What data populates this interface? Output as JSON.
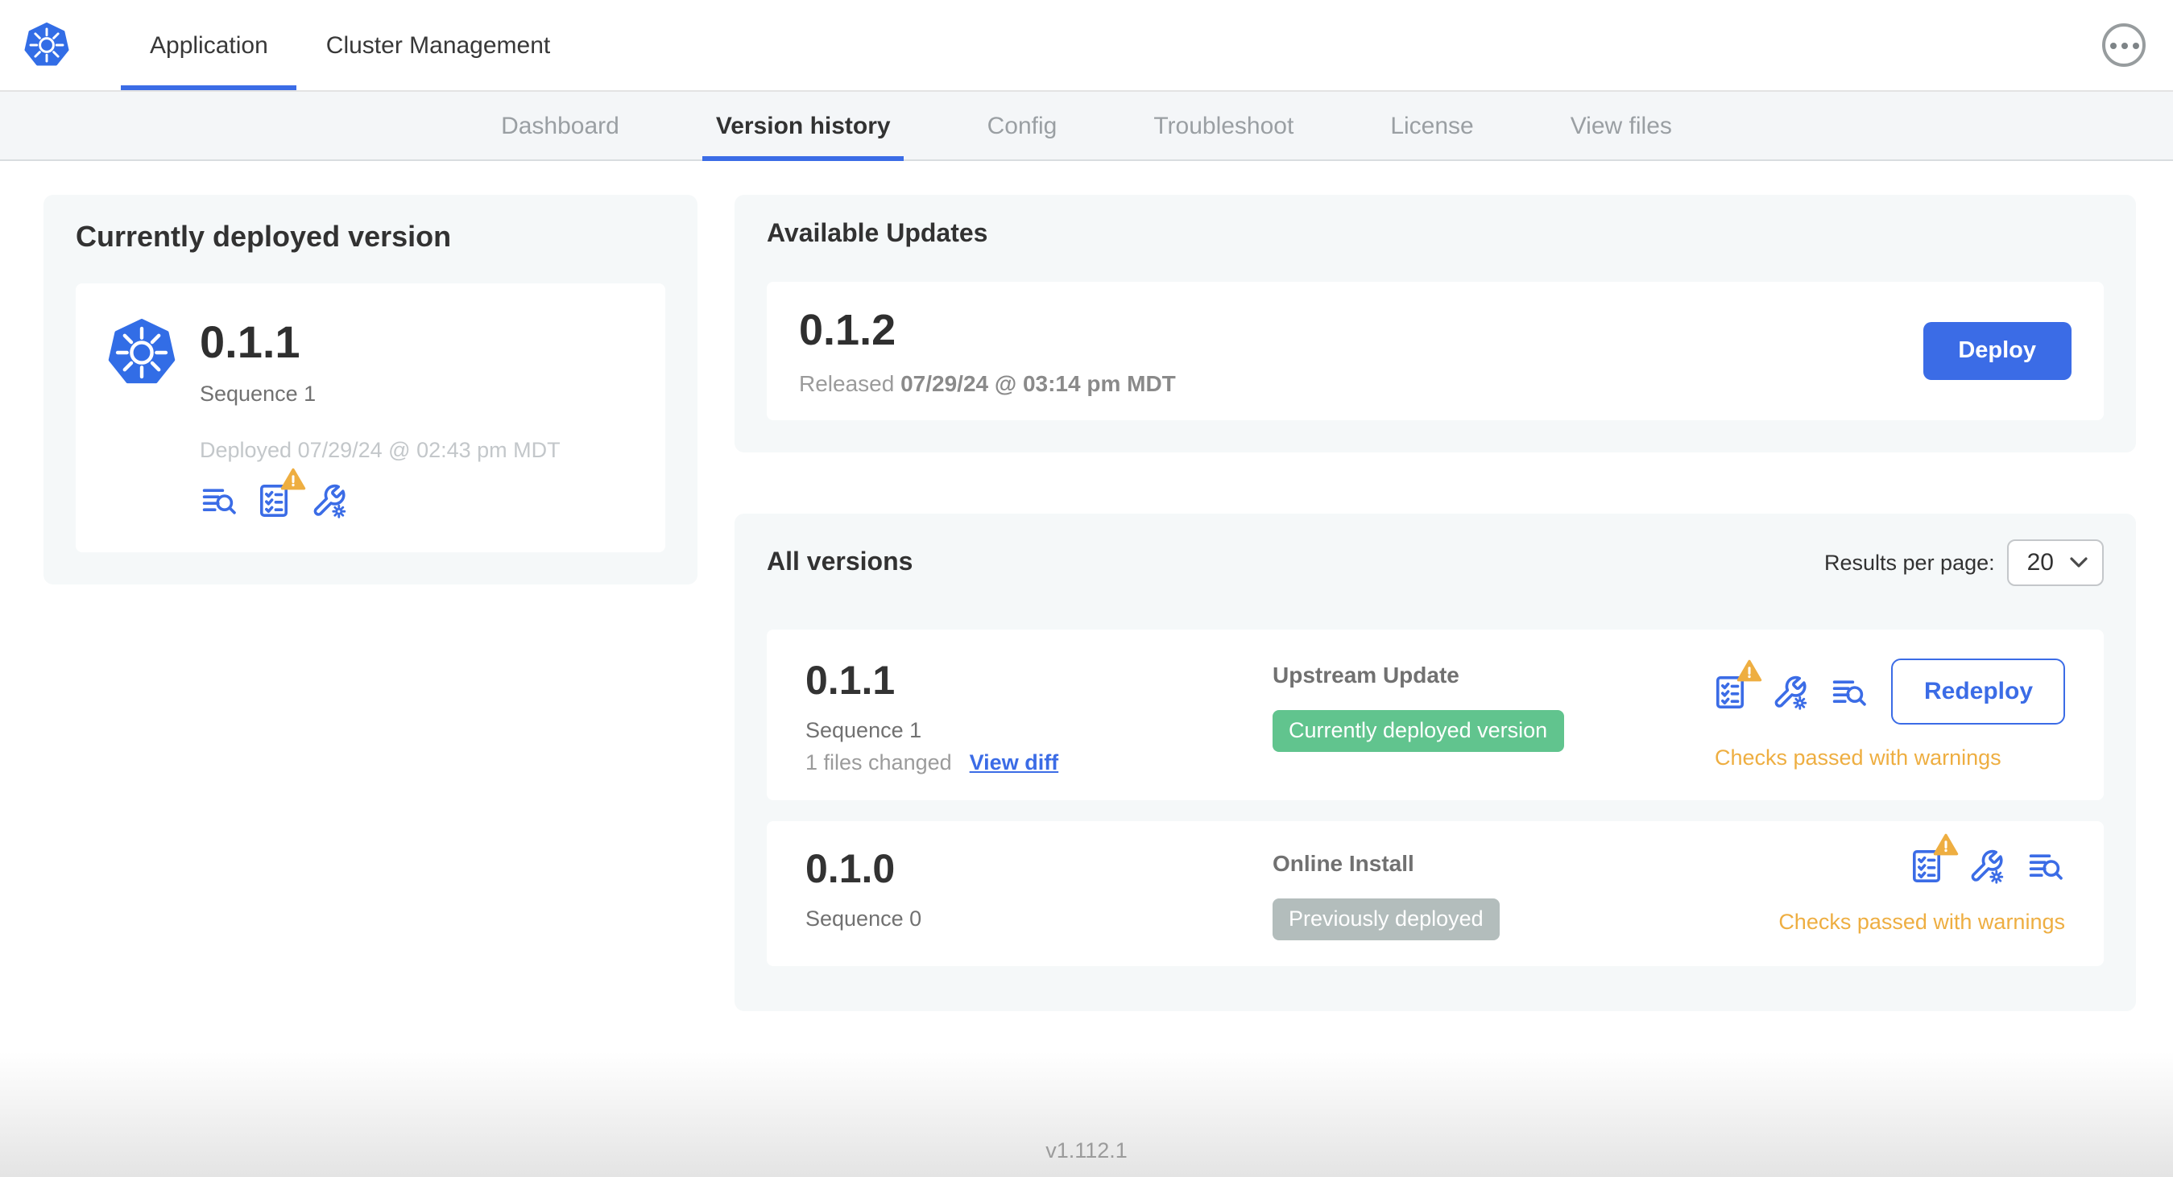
{
  "colors": {
    "accent_blue": "#3b6ce6",
    "kubernetes_blue": "#326de6",
    "badge_green": "#61c48e",
    "badge_gray": "#b3bdbc",
    "warning_amber": "#eeae41",
    "panel_gray": "#f5f8f9",
    "subnav_gray": "#f4f6f8"
  },
  "header": {
    "logo_icon": "kubernetes-logo",
    "tabs": [
      {
        "label": "Application",
        "active": true
      },
      {
        "label": "Cluster Management",
        "active": false
      }
    ],
    "overflow_menu_icon": "ellipsis-in-circle"
  },
  "subnav": {
    "tabs": [
      {
        "label": "Dashboard",
        "active": false
      },
      {
        "label": "Version history",
        "active": true
      },
      {
        "label": "Config",
        "active": false
      },
      {
        "label": "Troubleshoot",
        "active": false
      },
      {
        "label": "License",
        "active": false
      },
      {
        "label": "View files",
        "active": false
      }
    ]
  },
  "current": {
    "title": "Currently deployed version",
    "version": "0.1.1",
    "sequence": "Sequence 1",
    "deployed": "Deployed 07/29/24 @ 02:43 pm MDT",
    "icons": [
      "deploy-logs-icon",
      "preflight-checks-warning-icon",
      "config-icon"
    ]
  },
  "updates": {
    "title": "Available Updates",
    "version": "0.1.2",
    "released_label": "Released",
    "released_date": "07/29/24 @ 03:14 pm MDT",
    "deploy_label": "Deploy"
  },
  "versions": {
    "title": "All versions",
    "results_label": "Results per page:",
    "results_value": "20",
    "rows": [
      {
        "version": "0.1.1",
        "sequence": "Sequence 1",
        "files_changed": "1 files changed",
        "view_diff": "View diff",
        "source": "Upstream Update",
        "badge": "Currently deployed version",
        "badge_type": "green",
        "status": "Checks passed with warnings",
        "action": "Redeploy",
        "icons": [
          "preflight-checks-warning-icon",
          "config-icon",
          "deploy-logs-icon"
        ]
      },
      {
        "version": "0.1.0",
        "sequence": "Sequence 0",
        "source": "Online Install",
        "badge": "Previously deployed",
        "badge_type": "gray",
        "status": "Checks passed with warnings",
        "icons": [
          "preflight-checks-warning-icon",
          "config-icon",
          "deploy-logs-icon"
        ]
      }
    ]
  },
  "footer": {
    "version": "v1.112.1"
  }
}
